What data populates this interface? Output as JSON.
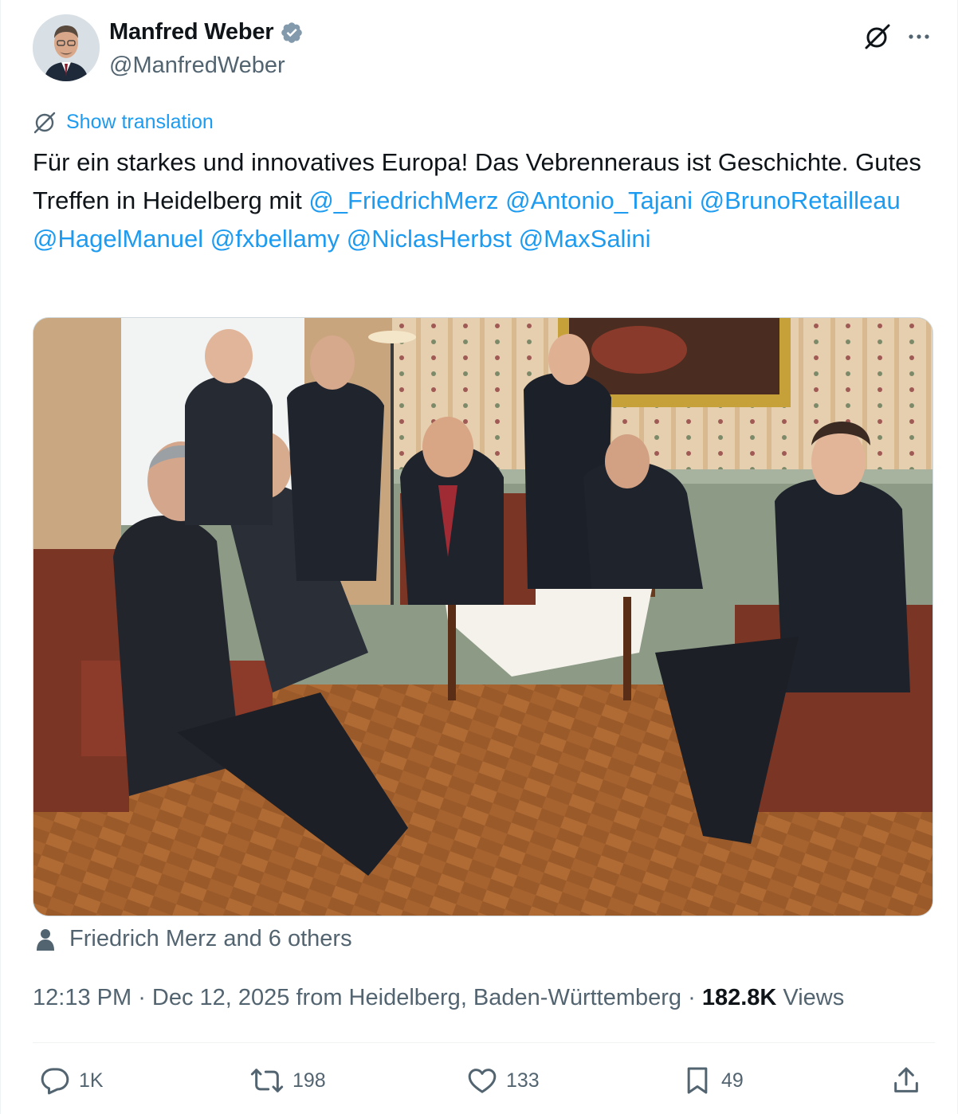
{
  "author": {
    "name": "Manfred Weber",
    "handle": "@ManfredWeber"
  },
  "translation": {
    "label": "Show translation"
  },
  "tweet": {
    "text_1": "Für ein starkes und innovatives Europa! Das Vebrenneraus ist Geschichte. Gutes Treffen in Heidelberg mit ",
    "mentions": [
      "@_FriedrichMerz",
      "@Antonio_Tajani",
      "@BrunoRetailleau",
      "@HagelManuel",
      "@fxbellamy",
      "@NiclasHerbst",
      "@MaxSalini"
    ]
  },
  "tagged": {
    "label": "Friedrich Merz and 6 others"
  },
  "meta": {
    "time": "12:13 PM",
    "date": "Dec 12, 2025",
    "location": "from Heidelberg, Baden-Württemberg",
    "views_count": "182.8K",
    "views_label": "Views"
  },
  "actions": {
    "replies": "1K",
    "reposts": "198",
    "likes": "133",
    "bookmarks": "49"
  },
  "colors": {
    "accent": "#1d9bf0",
    "text": "#0f1419",
    "muted": "#536471"
  },
  "icons": [
    "verified-badge-icon",
    "grok-icon",
    "more-icon",
    "translate-icon",
    "person-icon",
    "reply-icon",
    "repost-icon",
    "like-icon",
    "bookmark-icon",
    "share-icon"
  ]
}
